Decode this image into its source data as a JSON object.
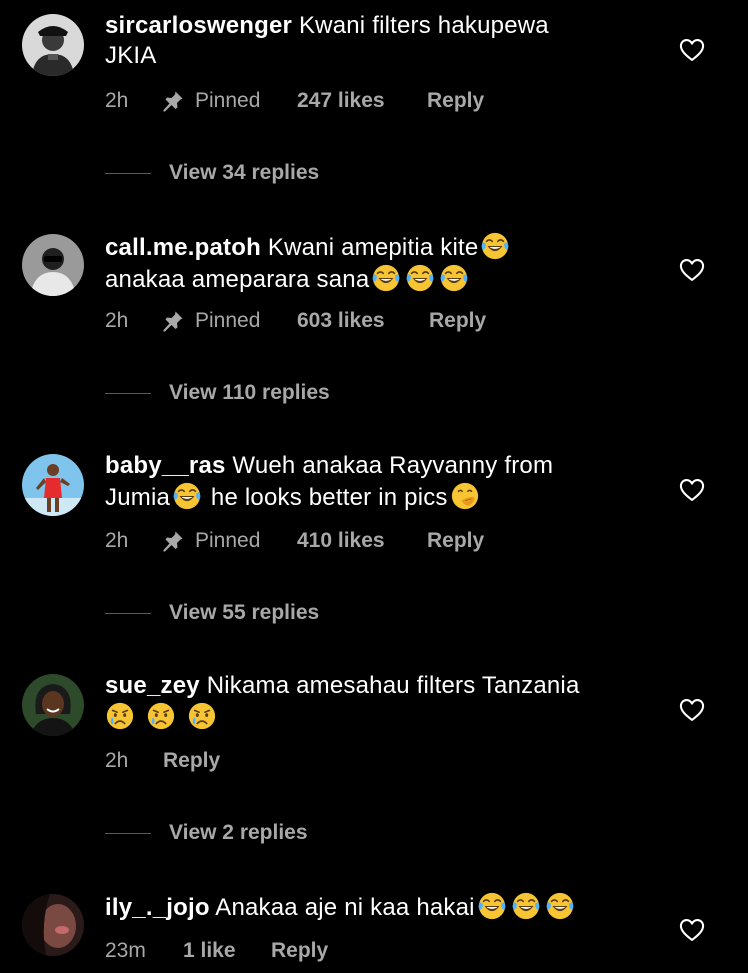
{
  "comments": [
    {
      "username": "sircarloswenger",
      "text_parts": [
        "Kwani filters hakupewa",
        "JKIA"
      ],
      "time": "2h",
      "pinned_label": "Pinned",
      "likes": "247 likes",
      "reply_label": "Reply",
      "view_replies": "View 34 replies"
    },
    {
      "username": "call.me.patoh",
      "text_parts": [
        "Kwani amepitia kite",
        "anakaa ameparara sana"
      ],
      "time": "2h",
      "pinned_label": "Pinned",
      "likes": "603 likes",
      "reply_label": "Reply",
      "view_replies": "View 110 replies"
    },
    {
      "username": "baby__ras",
      "text_parts": [
        "Wueh anakaa Rayvanny from",
        "Jumia",
        " he looks better in pics"
      ],
      "time": "2h",
      "pinned_label": "Pinned",
      "likes": "410 likes",
      "reply_label": "Reply",
      "view_replies": "View 55 replies"
    },
    {
      "username": "sue_zey",
      "text_parts": [
        "Nikama amesahau filters Tanzania"
      ],
      "time": "2h",
      "reply_label": "Reply",
      "view_replies": "View 2 replies"
    },
    {
      "username": "ily_._jojo",
      "text_parts": [
        "Anakaa aje ni kaa hakai"
      ],
      "time": "23m",
      "likes": "1 like",
      "reply_label": "Reply"
    }
  ],
  "icons": {
    "like": "heart-outline-icon",
    "pinned": "pin-icon",
    "laughing": "tears-of-joy-emoji",
    "crying": "crying-face-emoji",
    "shushing": "face-with-hand-over-mouth-emoji"
  },
  "colors": {
    "background": "#000000",
    "primary_text": "#ffffff",
    "secondary_text": "#a8a8a8",
    "divider": "#5a5a5a"
  }
}
